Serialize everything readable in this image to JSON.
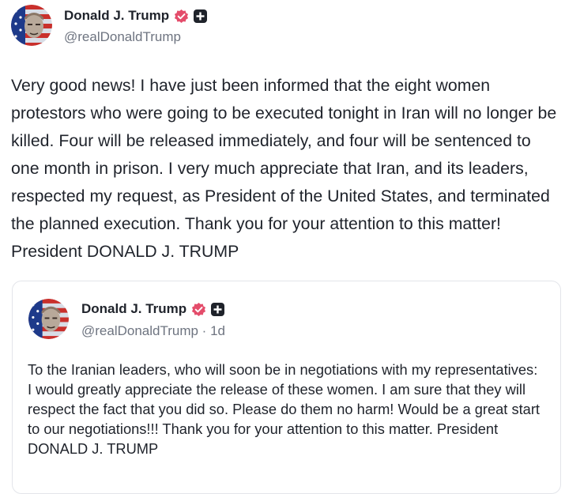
{
  "post": {
    "author": {
      "display_name": "Donald J. Trump",
      "handle": "@realDonaldTrump",
      "avatar_icon": "avatar-image",
      "verified_icon": "verified-badge-icon",
      "extra_icon": "plus-badge-icon"
    },
    "text": "Very good news! I have just been informed that the eight women protestors who were going to be executed tonight in Iran will no longer be killed. Four will be released immediately, and four will be sentenced to one month in prison. I very much appreciate that Iran, and its leaders, respected my request, as President of the United States, and terminated the planned execution. Thank you for your attention to this matter! President DONALD J. TRUMP"
  },
  "quoted_post": {
    "author": {
      "display_name": "Donald J. Trump",
      "handle_with_time": "@realDonaldTrump · 1d"
    },
    "text": "To the Iranian leaders, who will soon be in negotiations with my representatives: I would greatly appreciate the release of these women. I am sure that they will respect the fact that you did so. Please do them no harm! Would be a great start to our negotiations!!! Thank you for your attention to this matter. President DONALD J. TRUMP"
  },
  "colors": {
    "verified_badge": "#e44d6b",
    "plus_badge": "#1f232b",
    "text": "#1f232b",
    "muted": "#6e7480",
    "card_border": "#e3e5ea"
  }
}
